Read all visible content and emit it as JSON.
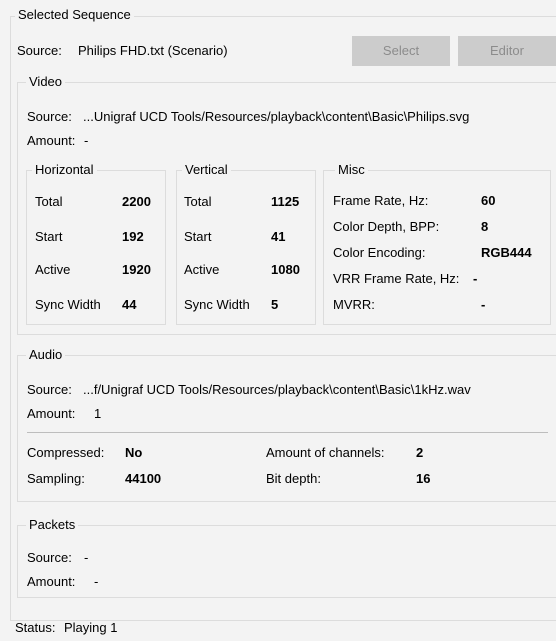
{
  "selected_sequence": {
    "legend": "Selected Sequence",
    "source_label": "Source:",
    "source_value": "Philips FHD.txt (Scenario)",
    "select_button": "Select",
    "editor_button": "Editor"
  },
  "video": {
    "legend": "Video",
    "source_label": "Source:",
    "source_value": "...Unigraf UCD Tools/Resources/playback\\content\\Basic\\Philips.svg",
    "amount_label": "Amount:",
    "amount_value": "-",
    "horizontal": {
      "legend": "Horizontal",
      "rows": [
        {
          "label": "Total",
          "value": "2200"
        },
        {
          "label": "Start",
          "value": "192"
        },
        {
          "label": "Active",
          "value": "1920"
        },
        {
          "label": "Sync Width",
          "value": "44"
        }
      ]
    },
    "vertical": {
      "legend": "Vertical",
      "rows": [
        {
          "label": "Total",
          "value": "1125"
        },
        {
          "label": "Start",
          "value": "41"
        },
        {
          "label": "Active",
          "value": "1080"
        },
        {
          "label": "Sync Width",
          "value": "5"
        }
      ]
    },
    "misc": {
      "legend": "Misc",
      "rows": [
        {
          "label": "Frame Rate, Hz:",
          "value": "60"
        },
        {
          "label": "Color Depth, BPP:",
          "value": "8"
        },
        {
          "label": "Color Encoding:",
          "value": "RGB444"
        },
        {
          "label": "VRR Frame Rate, Hz:",
          "value": "-"
        },
        {
          "label": "MVRR:",
          "value": "-"
        }
      ]
    }
  },
  "audio": {
    "legend": "Audio",
    "source_label": "Source:",
    "source_value": "...f/Unigraf UCD Tools/Resources/playback\\content\\Basic\\1kHz.wav",
    "amount_label": "Amount:",
    "amount_value": "1",
    "compressed_label": "Compressed:",
    "compressed_value": "No",
    "sampling_label": "Sampling:",
    "sampling_value": "44100",
    "channels_label": "Amount of channels:",
    "channels_value": "2",
    "bitdepth_label": "Bit depth:",
    "bitdepth_value": "16"
  },
  "packets": {
    "legend": "Packets",
    "source_label": "Source:",
    "source_value": "-",
    "amount_label": "Amount:",
    "amount_value": "-"
  },
  "status": {
    "label": "Status:",
    "value": "Playing 1"
  }
}
